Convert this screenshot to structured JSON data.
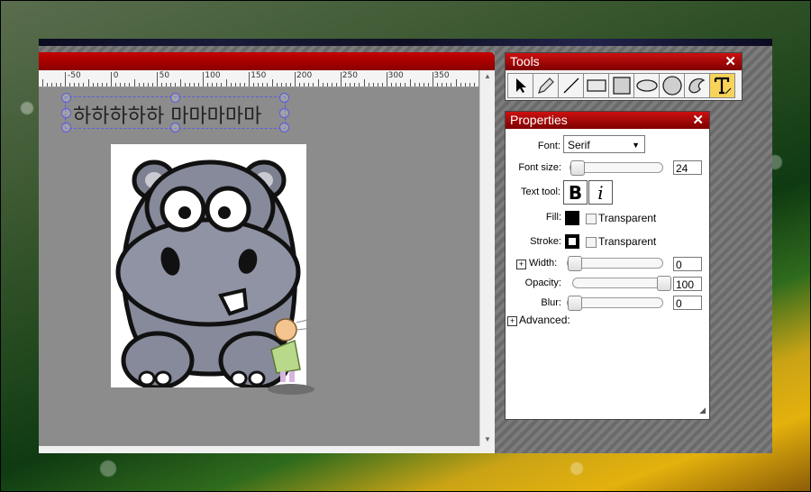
{
  "ruler": {
    "labels": [
      "-50",
      "0",
      "50",
      "100",
      "150",
      "200",
      "250",
      "300",
      "350",
      "40"
    ]
  },
  "canvas": {
    "text_object": "하하하하하 마마마마마"
  },
  "tools": {
    "title": "Tools",
    "close": "✕",
    "items": [
      {
        "name": "select-tool",
        "icon": "arrow-pointer-icon"
      },
      {
        "name": "pencil-tool",
        "icon": "pencil-icon"
      },
      {
        "name": "line-tool",
        "icon": "line-icon"
      },
      {
        "name": "rectangle-tool",
        "icon": "rectangle-icon"
      },
      {
        "name": "filled-rectangle-tool",
        "icon": "filled-rectangle-icon"
      },
      {
        "name": "ellipse-tool",
        "icon": "ellipse-icon"
      },
      {
        "name": "circle-tool",
        "icon": "circle-icon"
      },
      {
        "name": "path-tool",
        "icon": "path-icon"
      },
      {
        "name": "text-tool",
        "icon": "text-icon",
        "active": true
      }
    ]
  },
  "properties": {
    "title": "Properties",
    "close": "✕",
    "font_label": "Font:",
    "font_value": "Serif",
    "font_size_label": "Font size:",
    "font_size_value": "24",
    "text_tool_label": "Text tool:",
    "bold_label": "B",
    "italic_label": "i",
    "fill_label": "Fill:",
    "fill_color": "#000000",
    "fill_transparent": "Transparent",
    "stroke_label": "Stroke:",
    "stroke_transparent": "Transparent",
    "width_label": "Width:",
    "width_value": "0",
    "opacity_label": "Opacity:",
    "opacity_value": "100",
    "blur_label": "Blur:",
    "blur_value": "0",
    "advanced_label": "Advanced:"
  }
}
